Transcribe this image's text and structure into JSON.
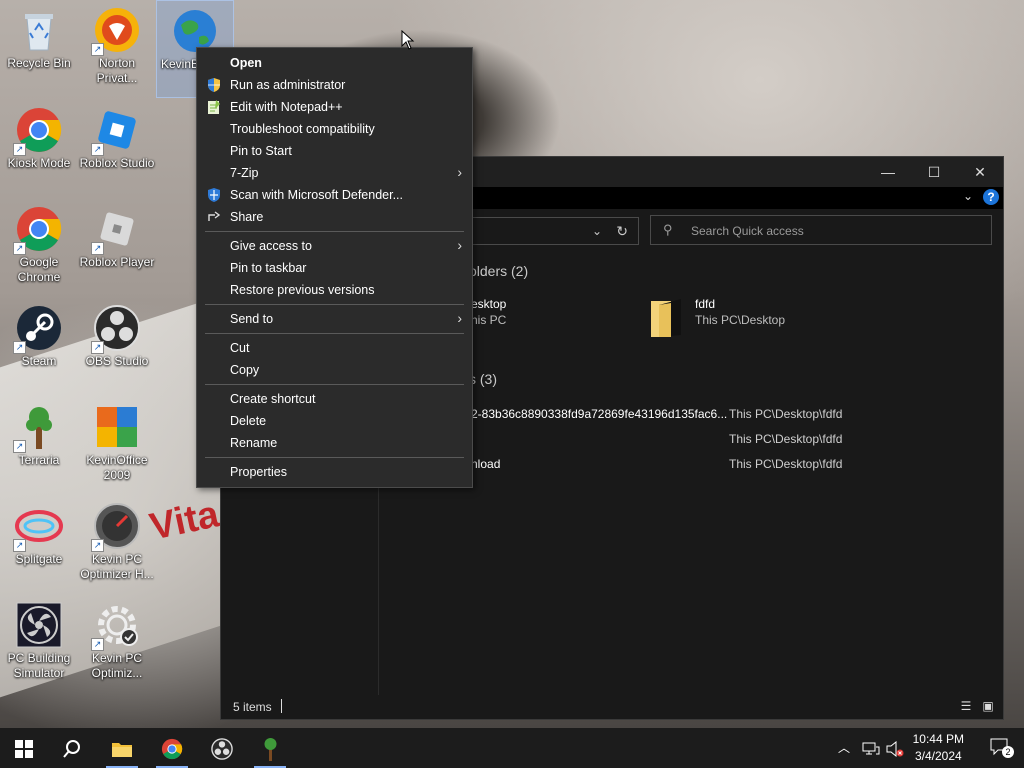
{
  "desktop": {
    "icons": [
      {
        "label": "Recycle Bin",
        "icon": "recycle-bin-icon"
      },
      {
        "label": "Norton Privat...",
        "icon": "norton-icon"
      },
      {
        "label": "KevinB",
        "icon": "globe-icon"
      },
      {
        "label": "Kiosk Mode",
        "icon": "chrome-icon"
      },
      {
        "label": "Roblox Studio",
        "icon": "roblox-studio-icon"
      },
      {
        "label": "Google Chrome",
        "icon": "chrome-icon"
      },
      {
        "label": "Roblox Player",
        "icon": "roblox-player-icon"
      },
      {
        "label": "Steam",
        "icon": "steam-icon"
      },
      {
        "label": "OBS Studio",
        "icon": "obs-icon"
      },
      {
        "label": "Terraria",
        "icon": "terraria-icon"
      },
      {
        "label": "KevinOffice 2009",
        "icon": "office-icon"
      },
      {
        "label": "Splitgate",
        "icon": "splitgate-icon"
      },
      {
        "label": "Kevin PC Optimizer H...",
        "icon": "speedometer-icon"
      },
      {
        "label": "PC Building Simulator",
        "icon": "fan-icon"
      },
      {
        "label": "Kevin PC Optimiz...",
        "icon": "gear-check-icon"
      }
    ]
  },
  "context_menu": {
    "items": [
      {
        "label": "Open",
        "bold": true
      },
      {
        "label": "Run as administrator",
        "icon": "uac-shield-icon"
      },
      {
        "label": "Edit with Notepad++",
        "icon": "notepad-icon"
      },
      {
        "label": "Troubleshoot compatibility"
      },
      {
        "label": "Pin to Start"
      },
      {
        "label": "7-Zip",
        "submenu": true
      },
      {
        "label": "Scan with Microsoft Defender...",
        "icon": "defender-shield-icon"
      },
      {
        "label": "Share",
        "icon": "share-icon"
      },
      {
        "label": "Give access to",
        "submenu": true
      },
      {
        "label": "Pin to taskbar"
      },
      {
        "label": "Restore previous versions"
      },
      {
        "label": "Send to",
        "submenu": true
      },
      {
        "label": "Cut"
      },
      {
        "label": "Copy"
      },
      {
        "label": "Create shortcut"
      },
      {
        "label": "Delete"
      },
      {
        "label": "Rename"
      },
      {
        "label": "Properties"
      }
    ]
  },
  "explorer": {
    "search_placeholder": "Search Quick access",
    "folders_header": "olders (2)",
    "folders": [
      {
        "name": "esktop",
        "location": "his PC"
      },
      {
        "name": "fdfd",
        "location": "This PC\\Desktop"
      }
    ],
    "files_header": "s (3)",
    "files": [
      {
        "name": "2-83b36c8890338fd9a72869fe43196d135fac6...",
        "location": "This PC\\Desktop\\fdfd"
      },
      {
        "name": "",
        "location": "This PC\\Desktop\\fdfd"
      },
      {
        "name": "nload",
        "location": "This PC\\Desktop\\fdfd"
      }
    ],
    "status_count": "5 items"
  },
  "taskbar": {
    "time": "10:44 PM",
    "date": "3/4/2024",
    "notification_count": "2",
    "colors": {
      "background": "#1c1c1c",
      "accent": "#8ab4f8"
    }
  }
}
